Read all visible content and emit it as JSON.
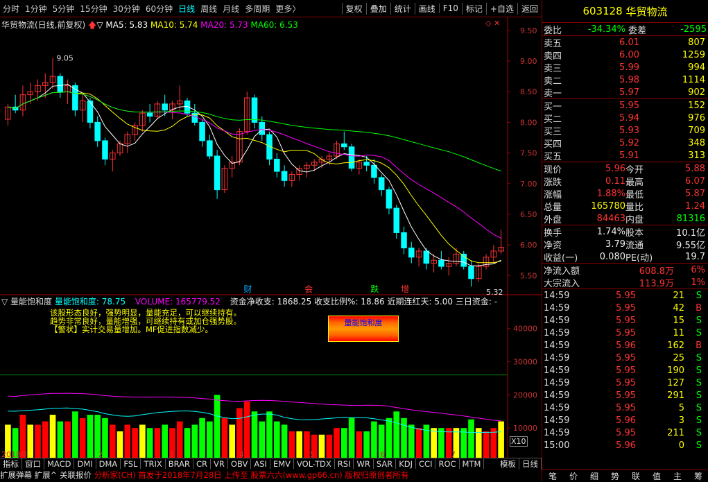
{
  "toolbar": {
    "periods": [
      "分时",
      "1分钟",
      "5分钟",
      "15分钟",
      "30分钟",
      "60分钟",
      "日线",
      "周线",
      "月线",
      "多周期",
      "更多〉"
    ],
    "active": "日线",
    "buttons": [
      "复权",
      "叠加",
      "统计",
      "画线",
      "F10",
      "标记",
      "+自选",
      "返回"
    ]
  },
  "main": {
    "title": "华贸物流(日线,前复权)",
    "arrow": "▽",
    "ma": [
      {
        "label": "MA5: 5.83",
        "color": "#ffffff"
      },
      {
        "label": "MA10: 5.74",
        "color": "#ffff00"
      },
      {
        "label": "MA20: 5.73",
        "color": "#ff00ff"
      },
      {
        "label": "MA60: 6.53",
        "color": "#00ff00"
      }
    ],
    "yticks": [
      "9.50",
      "9.00",
      "8.50",
      "8.00",
      "7.50",
      "7.00",
      "6.50",
      "6.00",
      "5.50"
    ],
    "high_label": "9.05",
    "low_label": "5.32",
    "markers": [
      {
        "text": "财",
        "color": "#0af"
      },
      {
        "text": "会",
        "color": "#f33"
      },
      {
        "text": "跌",
        "color": "#0f0"
      },
      {
        "text": "增",
        "color": "#f33"
      }
    ]
  },
  "sub": {
    "title": "▽ 量能饱和度",
    "name": "量能饱和度: 78.75",
    "volume": "VOLUME: 165779.52",
    "capital": "资金净收支: 1868.25 收支比例%: 18.86 近期连红天: 5.00 三日资金: -",
    "notes": [
      "该股形态良好，强势明显，量能充足，可以继续持有。",
      "趋势非常良好，量能增强，可继续持有或加仓强势股。",
      "【警状】实计交易量增加。MF促进指数减少。"
    ],
    "legend_label": "量能饱和度",
    "yticks": [
      "40000",
      "30000",
      "20000",
      "10000"
    ],
    "x10": "X10",
    "xlabels": [
      "2018年",
      "2",
      "3",
      "4",
      "5",
      "6",
      "7"
    ]
  },
  "bottom": {
    "tabs": [
      "指标",
      "窗口",
      "MACD",
      "DMI",
      "DMA",
      "FSL",
      "TRIX",
      "BRAR",
      "CR",
      "VR",
      "OBV",
      "ASI",
      "EMV",
      "VOL-TDX",
      "RSI",
      "WR",
      "SAR",
      "KDJ",
      "CCI",
      "ROC",
      "MTM"
    ],
    "right_tabs": [
      "模板",
      "日线"
    ],
    "tabs2": [
      "扩展弹幕",
      "扩展^",
      "关联报价"
    ],
    "footer": "分析家(CH) 首发于2018年7月28日 上传至 股票六六(www.gp66.cn) 版权归原创者所有"
  },
  "quote": {
    "code": "603128",
    "name": "华贸物流",
    "weibi_label": "委比",
    "weibi": "-34.34%",
    "weicha_label": "委差",
    "weicha": "-2595",
    "asks": [
      {
        "l": "卖五",
        "p": "6.01",
        "v": "807"
      },
      {
        "l": "卖四",
        "p": "6.00",
        "v": "1259"
      },
      {
        "l": "卖三",
        "p": "5.99",
        "v": "994"
      },
      {
        "l": "卖二",
        "p": "5.98",
        "v": "1114"
      },
      {
        "l": "卖一",
        "p": "5.97",
        "v": "902"
      }
    ],
    "bids": [
      {
        "l": "买一",
        "p": "5.95",
        "v": "152"
      },
      {
        "l": "买二",
        "p": "5.94",
        "v": "976"
      },
      {
        "l": "买三",
        "p": "5.93",
        "v": "709"
      },
      {
        "l": "买四",
        "p": "5.92",
        "v": "348"
      },
      {
        "l": "买五",
        "p": "5.91",
        "v": "313"
      }
    ],
    "stats": [
      [
        "现价",
        "5.96",
        "今开",
        "5.88"
      ],
      [
        "涨跌",
        "0.11",
        "最高",
        "6.07"
      ],
      [
        "涨幅",
        "1.88%",
        "最低",
        "5.87"
      ],
      [
        "总量",
        "165780",
        "量比",
        "1.24"
      ],
      [
        "外盘",
        "84463",
        "内盘",
        "81316"
      ]
    ],
    "stats2": [
      [
        "换手",
        "1.74%",
        "股本",
        "10.1亿"
      ],
      [
        "净资",
        "3.79",
        "流通",
        "9.55亿"
      ],
      [
        "收益(一)",
        "0.080",
        "PE(动)",
        "19.7"
      ]
    ],
    "flow": [
      [
        "净流入额",
        "608.8万",
        "6%"
      ],
      [
        "大宗流入",
        "113.9万",
        "1%"
      ]
    ],
    "ticks": [
      [
        "14:59",
        "5.95",
        "21",
        "S"
      ],
      [
        "14:59",
        "5.95",
        "42",
        "B"
      ],
      [
        "14:59",
        "5.95",
        "15",
        "S"
      ],
      [
        "14:59",
        "5.95",
        "11",
        "S"
      ],
      [
        "14:59",
        "5.96",
        "162",
        "B"
      ],
      [
        "14:59",
        "5.95",
        "25",
        "S"
      ],
      [
        "14:59",
        "5.95",
        "190",
        "S"
      ],
      [
        "14:59",
        "5.95",
        "127",
        "S"
      ],
      [
        "14:59",
        "5.95",
        "291",
        "S"
      ],
      [
        "14:59",
        "5.95",
        "5",
        "S"
      ],
      [
        "14:59",
        "5.96",
        "3",
        "S"
      ],
      [
        "14:59",
        "5.95",
        "211",
        "S"
      ],
      [
        "15:00",
        "5.96",
        "0",
        "S"
      ]
    ],
    "bottom_tabs": [
      "笔",
      "价",
      "细",
      "势",
      "联",
      "值",
      "主",
      "筹"
    ]
  },
  "chart_data": {
    "type": "candlestick",
    "ma": {
      "MA5": 5.83,
      "MA10": 5.74,
      "MA20": 5.73,
      "MA60": 6.53
    },
    "y_range": [
      5.3,
      9.6
    ],
    "high": 9.05,
    "low": 5.32,
    "candles": [
      [
        8.05,
        8.3,
        7.95,
        8.25
      ],
      [
        8.25,
        8.45,
        8.15,
        8.2
      ],
      [
        8.2,
        8.6,
        8.1,
        8.45
      ],
      [
        8.45,
        8.65,
        8.3,
        8.5
      ],
      [
        8.5,
        8.7,
        8.35,
        8.6
      ],
      [
        8.6,
        8.8,
        8.4,
        8.65
      ],
      [
        8.65,
        9.05,
        8.55,
        8.75
      ],
      [
        8.75,
        8.8,
        8.4,
        8.5
      ],
      [
        8.5,
        8.7,
        8.3,
        8.6
      ],
      [
        8.6,
        8.65,
        8.1,
        8.2
      ],
      [
        8.2,
        8.45,
        8.0,
        8.35
      ],
      [
        8.35,
        8.4,
        7.9,
        8.0
      ],
      [
        8.0,
        8.1,
        7.6,
        7.7
      ],
      [
        7.7,
        7.75,
        7.3,
        7.4
      ],
      [
        7.4,
        7.55,
        7.2,
        7.5
      ],
      [
        7.5,
        7.7,
        7.45,
        7.65
      ],
      [
        7.65,
        7.85,
        7.5,
        7.8
      ],
      [
        7.8,
        8.0,
        7.7,
        7.95
      ],
      [
        7.95,
        8.2,
        7.85,
        8.15
      ],
      [
        8.15,
        8.3,
        8.0,
        8.1
      ],
      [
        8.1,
        8.35,
        8.05,
        8.3
      ],
      [
        8.3,
        8.45,
        8.1,
        8.2
      ],
      [
        8.2,
        8.35,
        8.05,
        8.3
      ],
      [
        8.3,
        8.6,
        8.2,
        8.35
      ],
      [
        8.35,
        8.4,
        8.1,
        8.15
      ],
      [
        8.15,
        8.3,
        7.95,
        8.0
      ],
      [
        8.0,
        8.05,
        7.6,
        7.7
      ],
      [
        7.7,
        7.8,
        7.4,
        7.45
      ],
      [
        7.45,
        7.55,
        6.75,
        6.9
      ],
      [
        6.9,
        7.3,
        6.85,
        7.25
      ],
      [
        7.25,
        7.45,
        7.1,
        7.35
      ],
      [
        7.35,
        7.9,
        7.3,
        7.85
      ],
      [
        7.85,
        8.5,
        7.8,
        8.4
      ],
      [
        8.4,
        8.45,
        7.9,
        8.0
      ],
      [
        8.0,
        8.1,
        7.7,
        7.8
      ],
      [
        7.8,
        7.85,
        7.3,
        7.4
      ],
      [
        7.4,
        7.5,
        7.1,
        7.2
      ],
      [
        7.2,
        7.3,
        6.95,
        7.05
      ],
      [
        7.05,
        7.2,
        6.95,
        7.15
      ],
      [
        7.15,
        7.3,
        7.05,
        7.25
      ],
      [
        7.25,
        7.35,
        7.1,
        7.3
      ],
      [
        7.3,
        7.4,
        7.2,
        7.35
      ],
      [
        7.35,
        7.45,
        7.25,
        7.4
      ],
      [
        7.4,
        7.5,
        7.3,
        7.45
      ],
      [
        7.45,
        7.7,
        7.4,
        7.65
      ],
      [
        7.65,
        7.85,
        7.55,
        7.6
      ],
      [
        7.6,
        7.65,
        7.2,
        7.25
      ],
      [
        7.25,
        7.4,
        7.15,
        7.35
      ],
      [
        7.35,
        7.45,
        7.2,
        7.3
      ],
      [
        7.3,
        7.4,
        7.0,
        7.1
      ],
      [
        7.1,
        7.15,
        6.8,
        6.9
      ],
      [
        6.9,
        6.95,
        6.5,
        6.6
      ],
      [
        6.6,
        6.65,
        6.1,
        6.2
      ],
      [
        6.2,
        6.3,
        5.85,
        5.95
      ],
      [
        5.95,
        6.05,
        5.7,
        5.8
      ],
      [
        5.8,
        5.95,
        5.65,
        5.9
      ],
      [
        5.9,
        5.95,
        5.6,
        5.7
      ],
      [
        5.7,
        5.85,
        5.55,
        5.75
      ],
      [
        5.75,
        5.9,
        5.6,
        5.65
      ],
      [
        5.65,
        5.8,
        5.5,
        5.7
      ],
      [
        5.7,
        5.95,
        5.65,
        5.85
      ],
      [
        5.85,
        5.9,
        5.6,
        5.65
      ],
      [
        5.65,
        5.75,
        5.32,
        5.45
      ],
      [
        5.45,
        5.7,
        5.4,
        5.65
      ],
      [
        5.65,
        5.85,
        5.6,
        5.8
      ],
      [
        5.8,
        6.0,
        5.7,
        5.9
      ],
      [
        5.9,
        6.25,
        5.85,
        5.96
      ]
    ],
    "volume_yticks": [
      40000,
      30000,
      20000,
      10000
    ],
    "volume": 165779.52
  }
}
